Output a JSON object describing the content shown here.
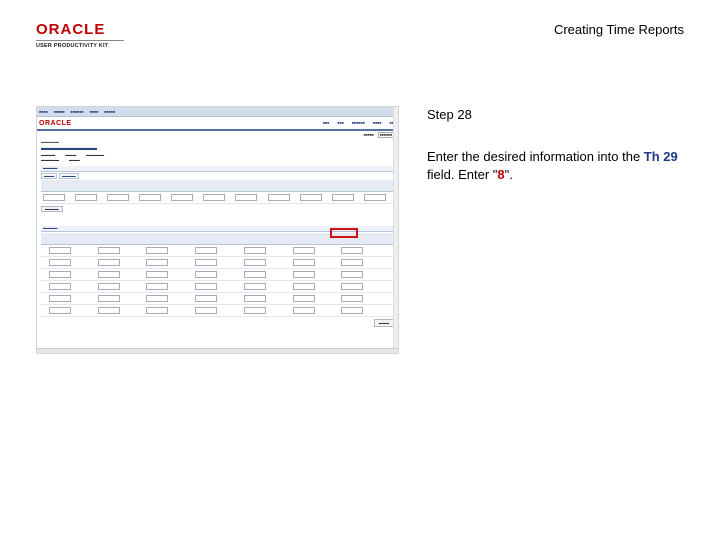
{
  "header": {
    "logo_text": "ORACLE",
    "logo_sub": "USER PRODUCTIVITY KIT",
    "doc_title": "Creating Time Reports"
  },
  "step": {
    "label": "Step 28",
    "instruction_1": "Enter the desired information into the ",
    "instruction_field": "Th 29",
    "instruction_2": " field. Enter \"",
    "instruction_value": "8",
    "instruction_3": "\"."
  },
  "colors": {
    "accent_red": "#c00000",
    "accent_blue": "#1f3a8a",
    "highlight_box": "#d01010"
  }
}
